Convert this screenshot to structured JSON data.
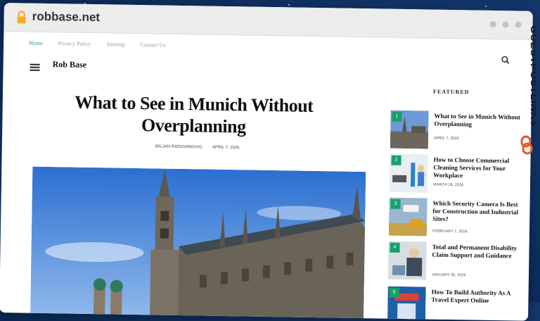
{
  "browser": {
    "domain": "robbase.net"
  },
  "nav": {
    "items": [
      "Home",
      "Privacy Policy",
      "Sitemap",
      "Contact Us"
    ]
  },
  "site": {
    "name": "Rob Base"
  },
  "article": {
    "title": "What to See in Munich Without Overplanning",
    "author": "MILJAN RADOVANOVIC",
    "date": "APRIL 7, 2026"
  },
  "featured": {
    "heading": "FEATURED",
    "items": [
      {
        "num": "1",
        "title": "What to See in Munich Without Overplanning",
        "date": "APRIL 7, 2026"
      },
      {
        "num": "2",
        "title": "How to Choose Commercial Cleaning Services for Your Workplace",
        "date": "MARCH 26, 2026"
      },
      {
        "num": "3",
        "title": "Which Security Camera Is Best for Construction and Industrial Sites?",
        "date": "FEBRUARY 1, 2026"
      },
      {
        "num": "4",
        "title": "Total and Permanent Disability Claim Support and Guidance",
        "date": "JANUARY 30, 2026"
      },
      {
        "num": "5",
        "title": "How To Build Authority As A Travel Expert Online",
        "date": ""
      }
    ]
  },
  "watermark": {
    "text": "GUESTPOSTLINKS"
  },
  "colors": {
    "accent": "#16a06c",
    "background": "#0d2c5c",
    "logo": "#e8562a"
  }
}
